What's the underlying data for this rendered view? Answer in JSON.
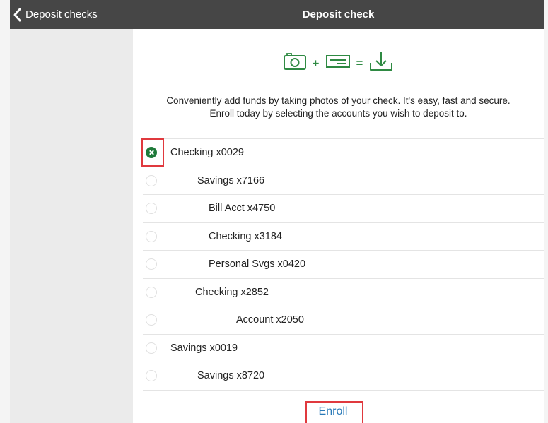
{
  "header": {
    "back_label": "Deposit checks",
    "title": "Deposit check"
  },
  "hero": {
    "icons": [
      "camera-icon",
      "plus-icon",
      "check-card-icon",
      "equals-icon",
      "download-icon"
    ],
    "plus": "+",
    "equals": "="
  },
  "description": {
    "line1": "Conveniently add funds by taking photos of your check. It's easy, fast and secure.",
    "line2": "Enroll today by selecting the accounts you wish to deposit to."
  },
  "accounts": [
    {
      "label": "Checking x0029",
      "selected": true
    },
    {
      "label": "Savings x7166",
      "selected": false
    },
    {
      "label": "Bill Acct x4750",
      "selected": false
    },
    {
      "label": "Checking x3184",
      "selected": false
    },
    {
      "label": "Personal Svgs x0420",
      "selected": false
    },
    {
      "label": "Checking x2852",
      "selected": false
    },
    {
      "label": "Account x2050",
      "selected": false
    },
    {
      "label": "Savings x0019",
      "selected": false
    },
    {
      "label": "Savings x8720",
      "selected": false
    }
  ],
  "enroll_label": "Enroll",
  "colors": {
    "header_bg": "#464646",
    "accent_green": "#1f7a3a",
    "link_blue": "#2a7ab8",
    "highlight_red": "#e0393e"
  }
}
